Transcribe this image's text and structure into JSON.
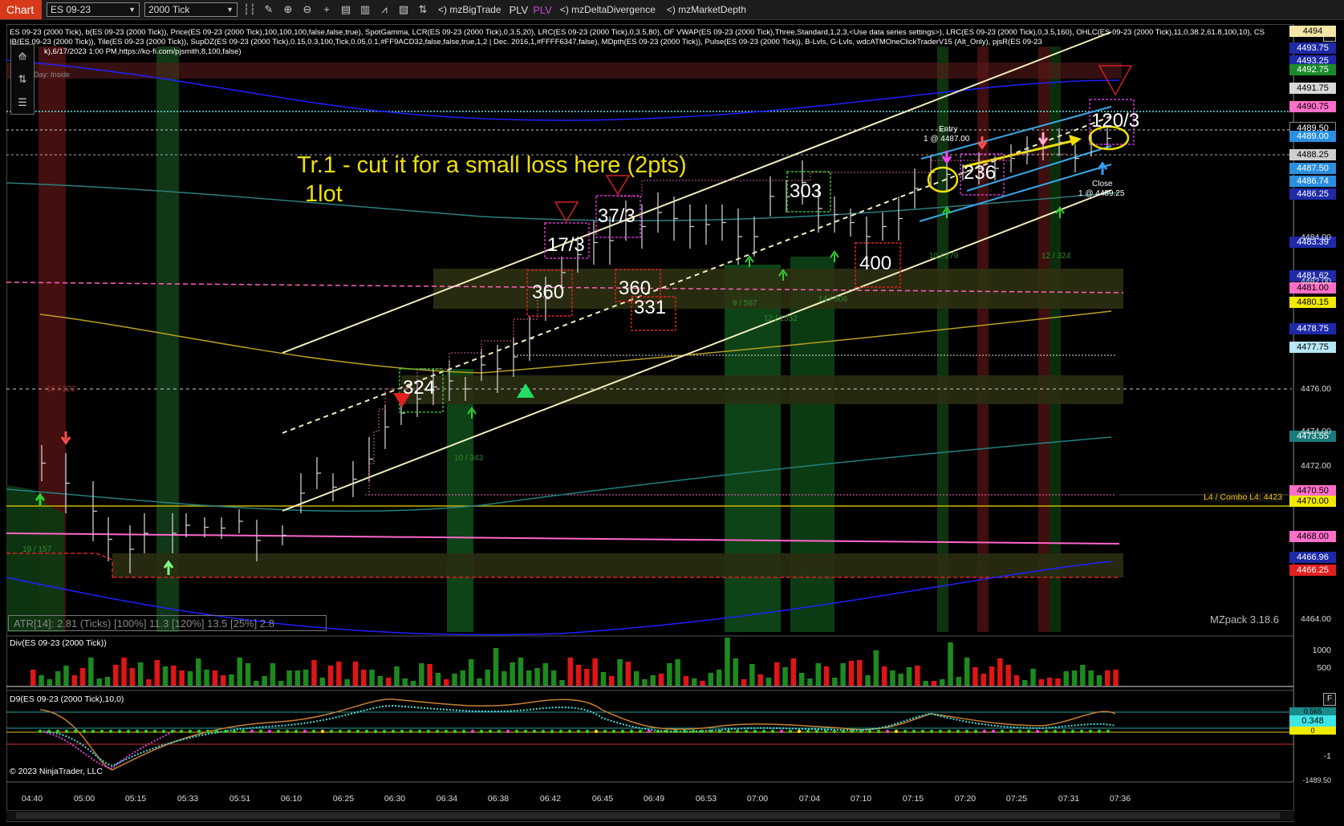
{
  "toolbar": {
    "tab_label": "Chart",
    "instrument": "ES 09-23",
    "period": "2000 Tick",
    "mzBigTrade": "mzBigTrade",
    "plv1": "PLV",
    "plv2": "PLV",
    "mzDeltaDivergence": "mzDeltaDivergence",
    "mzMarketDepth": "mzMarketDepth"
  },
  "indicators": {
    "line1": "ES 09-23 (2000 Tick), b(ES 09-23 (2000 Tick)), Price(ES 09-23 (2000 Tick),100,100,100,false,false,true), SpotGamma, LCR(ES 09-23 (2000 Tick),0,3.5,20), LRC(ES 09-23 (2000 Tick),0,3.5,80), OF VWAP(ES 09-23 (2000 Tick),Three,Standard,1,2,3,<Use data series settings>), LRC(ES 09-23 (2000 Tick),0,3.5,160), OHLC(ES 09-23 (2000 Tick),11,0,38.2,61.8,100,10), CS IB(ES 09-23 (2000 Tick)), Tile(ES 09-23 (2000 Tick)), SupDZ(ES 09-23 (2000 Tick),0.15,0.3,100,Tick,0.05,0.1,#FF9ACD32,false,false,true,1,2 | Dec. 2016,1,#FFFF6347,false), MDpth(ES 09-23 (2000 Tick)), Pulse(ES 09-23 (2000 Tick)), B-Lvls, G-Lvls, wdcATMOneClickTraderV15 (Alt_Only), pjsR(ES 09-23",
    "line3": "k),6/17/2023 1:00 PM,https://ko-fi.com/pjsmith,8,100,false)",
    "day_label": "Day: Inside"
  },
  "annotations": {
    "main_note_line1": "Tr.1 - cut it for a small loss here (2pts)",
    "main_note_line2": "1lot",
    "entry_label": "Entry",
    "entry_detail": "1 @ 4487.00",
    "close_label": "Close",
    "close_detail": "1 @ 4489.25",
    "combo_label": "L4 / Combo L4: 4423"
  },
  "box_numbers": {
    "n324": "324",
    "n360a": "360",
    "n17_3": "17/3",
    "n37_3": "37/3",
    "n360b": "360",
    "n331": "331",
    "n303": "303",
    "n400": "400",
    "n236": "236",
    "n120_3": "120/3"
  },
  "small_labels": {
    "l19_157": "19 / 157",
    "l16_322": "16 / 322",
    "l10_343": "10 / 343",
    "l9_597": "9 / 597",
    "l12_1552": "12 / 1552",
    "l14_606": "14 / 606",
    "l10_279": "10 / 279",
    "l12_324": "12 / 324"
  },
  "price_axis": {
    "tags": [
      {
        "v": "4494",
        "bg": "#f5e6a8",
        "fg": "#000"
      },
      {
        "v": "4493.75",
        "bg": "#1f2aa8",
        "fg": "#fff"
      },
      {
        "v": "4493.25",
        "bg": "#1f2aa8",
        "fg": "#fff"
      },
      {
        "v": "4492.75",
        "bg": "#1a8a2a",
        "fg": "#fff"
      },
      {
        "v": "4491.75",
        "bg": "#d8d8d8",
        "fg": "#000"
      },
      {
        "v": "4490.75",
        "bg": "#ff6fc9",
        "fg": "#000"
      },
      {
        "v": "4489.50",
        "bg": "#000",
        "fg": "#fff"
      },
      {
        "v": "4489.00",
        "bg": "#2b8fe0",
        "fg": "#fff"
      },
      {
        "v": "4488.25",
        "bg": "#cfcfcf",
        "fg": "#000"
      },
      {
        "v": "4487.50",
        "bg": "#2b8fe0",
        "fg": "#fff"
      },
      {
        "v": "4486.74",
        "bg": "#2b8fe0",
        "fg": "#fff"
      },
      {
        "v": "4486.25",
        "bg": "#1f2aa8",
        "fg": "#fff"
      },
      {
        "v": "4483.39",
        "bg": "#1f2aa8",
        "fg": "#fff"
      },
      {
        "v": "4481.62",
        "bg": "#1f2aa8",
        "fg": "#fff"
      },
      {
        "v": "4481.00",
        "bg": "#ff6fc9",
        "fg": "#000"
      },
      {
        "v": "4480.15",
        "bg": "#f0ea00",
        "fg": "#000"
      },
      {
        "v": "4478.75",
        "bg": "#1f2aa8",
        "fg": "#fff"
      },
      {
        "v": "4477.75",
        "bg": "#b8e8f5",
        "fg": "#000"
      },
      {
        "v": "4473.55",
        "bg": "#1a7a7a",
        "fg": "#fff"
      },
      {
        "v": "4470.50",
        "bg": "#ff6fc9",
        "fg": "#000"
      },
      {
        "v": "4470.00",
        "bg": "#f0ea00",
        "fg": "#000"
      },
      {
        "v": "4468.00",
        "bg": "#ff6fc9",
        "fg": "#000"
      },
      {
        "v": "4466.96",
        "bg": "#1f2aa8",
        "fg": "#fff"
      },
      {
        "v": "4466.25",
        "bg": "#e02020",
        "fg": "#fff"
      }
    ],
    "plain": [
      "4484.00",
      "4482.00",
      "4476.00",
      "4474.00",
      "4472.00",
      "4464.00"
    ]
  },
  "time_axis": [
    "04:40",
    "05:00",
    "05:15",
    "05:33",
    "05:51",
    "06:10",
    "06:25",
    "06:30",
    "06:34",
    "06:38",
    "06:42",
    "06:45",
    "06:49",
    "06:53",
    "07:00",
    "07:04",
    "07:10",
    "07:15",
    "07:20",
    "07:25",
    "07:31",
    "07:36"
  ],
  "panels": {
    "atr": "ATR[14]: 2.81 (Ticks) [100%] 11.3  [120%] 13.5  [25%] 2.8",
    "mzpack": "MZpack 3.18.6",
    "div_title": "Div(ES 09-23 (2000 Tick))",
    "div_ticks": [
      "1000",
      "500"
    ],
    "d9_title": "D9(ES 09-23 (2000 Tick),10,0)",
    "d9_value": "0.348",
    "d9_ticks": [
      "0",
      "-1"
    ],
    "d9_zero_top": "0.565",
    "d9_last": "-1489.50",
    "copyright": "© 2023 NinjaTrader, LLC",
    "f_button": "F"
  },
  "colors": {
    "background": "#000000",
    "bull_volume": "#1d8a1d",
    "bear_volume": "#e01515",
    "annotation_yellow": "#f0e000",
    "magenta_box": "#d030d0"
  }
}
